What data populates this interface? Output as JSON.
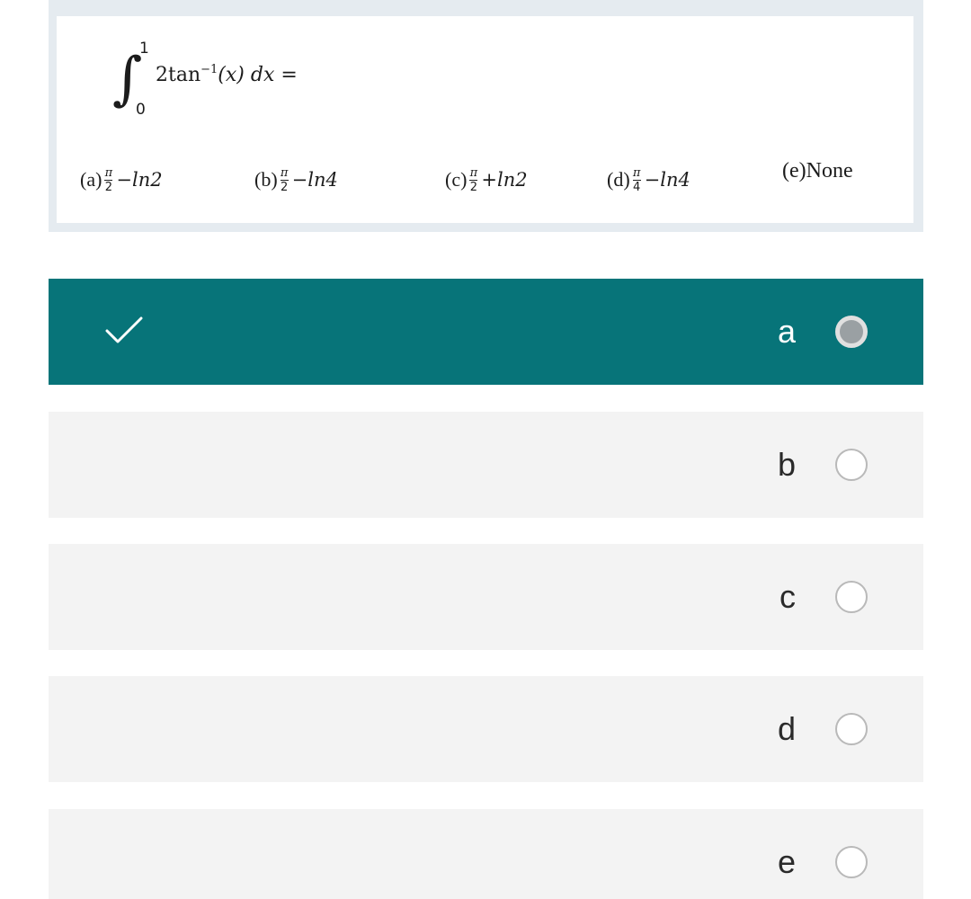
{
  "question": {
    "integral": {
      "sign": "∫",
      "upper_limit": "1",
      "lower_limit": "0",
      "coefficient": "2tan",
      "exponent": "−1",
      "argument": "(x) dx ="
    },
    "choices": [
      {
        "label": "(a)",
        "numerator": "π",
        "denominator": "2",
        "operator": "− ",
        "term": "ln2"
      },
      {
        "label": "(b)",
        "numerator": "π",
        "denominator": "2",
        "operator": "− ",
        "term": "ln4"
      },
      {
        "label": "(c)",
        "numerator": "π",
        "denominator": "2",
        "operator": "+ ",
        "term": "ln2"
      },
      {
        "label": "(d)",
        "numerator": "π",
        "denominator": "4",
        "operator": "− ",
        "term": "ln4"
      },
      {
        "label": "(e)None"
      }
    ]
  },
  "options": [
    {
      "label": "a",
      "selected": true
    },
    {
      "label": "b",
      "selected": false
    },
    {
      "label": "c",
      "selected": false
    },
    {
      "label": "d",
      "selected": false
    },
    {
      "label": "e",
      "selected": false
    }
  ],
  "colors": {
    "selected_background": "#077479",
    "option_background": "#f3f3f3",
    "card_border": "#e5ebf0",
    "check_icon": "#ffffff"
  },
  "icons": {
    "selected_indicator": "check-icon",
    "option_control": "radio-icon"
  }
}
